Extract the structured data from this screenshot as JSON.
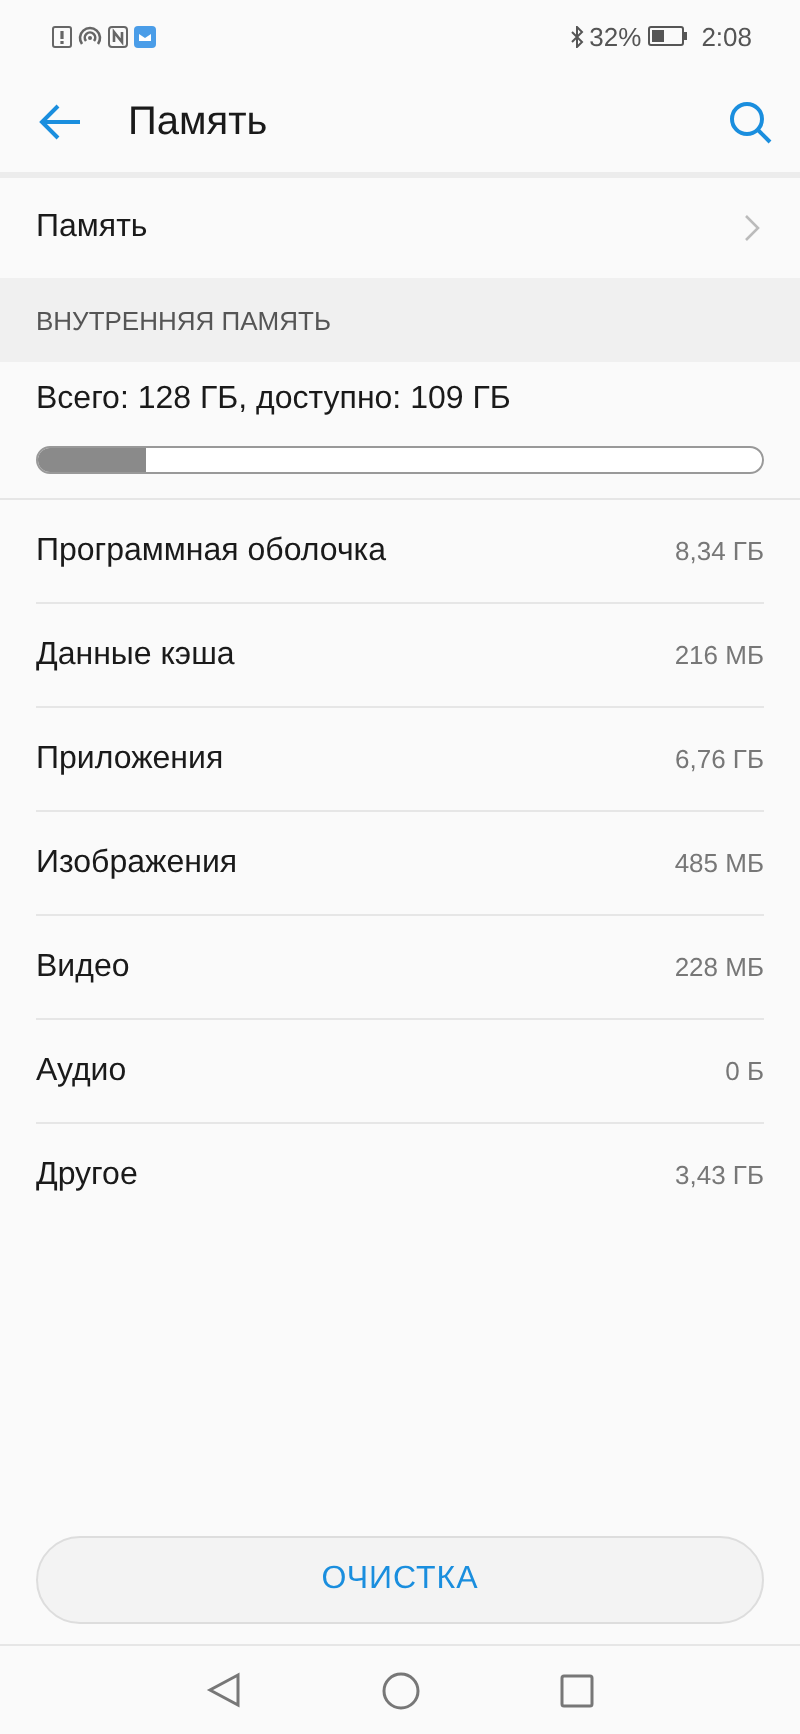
{
  "status_bar": {
    "battery": "32%",
    "time": "2:08"
  },
  "toolbar": {
    "title": "Память"
  },
  "memory_row": {
    "label": "Память"
  },
  "section": {
    "title": "ВНУТРЕННЯЯ ПАМЯТЬ"
  },
  "summary": {
    "text": "Всего: 128 ГБ, доступно: 109 ГБ",
    "level": 0.15
  },
  "items": [
    {
      "name": "Программная оболочка",
      "size": "8,34 ГБ"
    },
    {
      "name": "Данные кэша",
      "size": "216 МБ"
    },
    {
      "name": "Приложения",
      "size": "6,76 ГБ"
    },
    {
      "name": "Изображения",
      "size": "485 МБ"
    },
    {
      "name": "Видео",
      "size": "228 МБ"
    },
    {
      "name": "Аудио",
      "size": "0 Б"
    },
    {
      "name": "Другое",
      "size": "3,43 ГБ"
    }
  ],
  "clean_button": "ОЧИСТКА"
}
